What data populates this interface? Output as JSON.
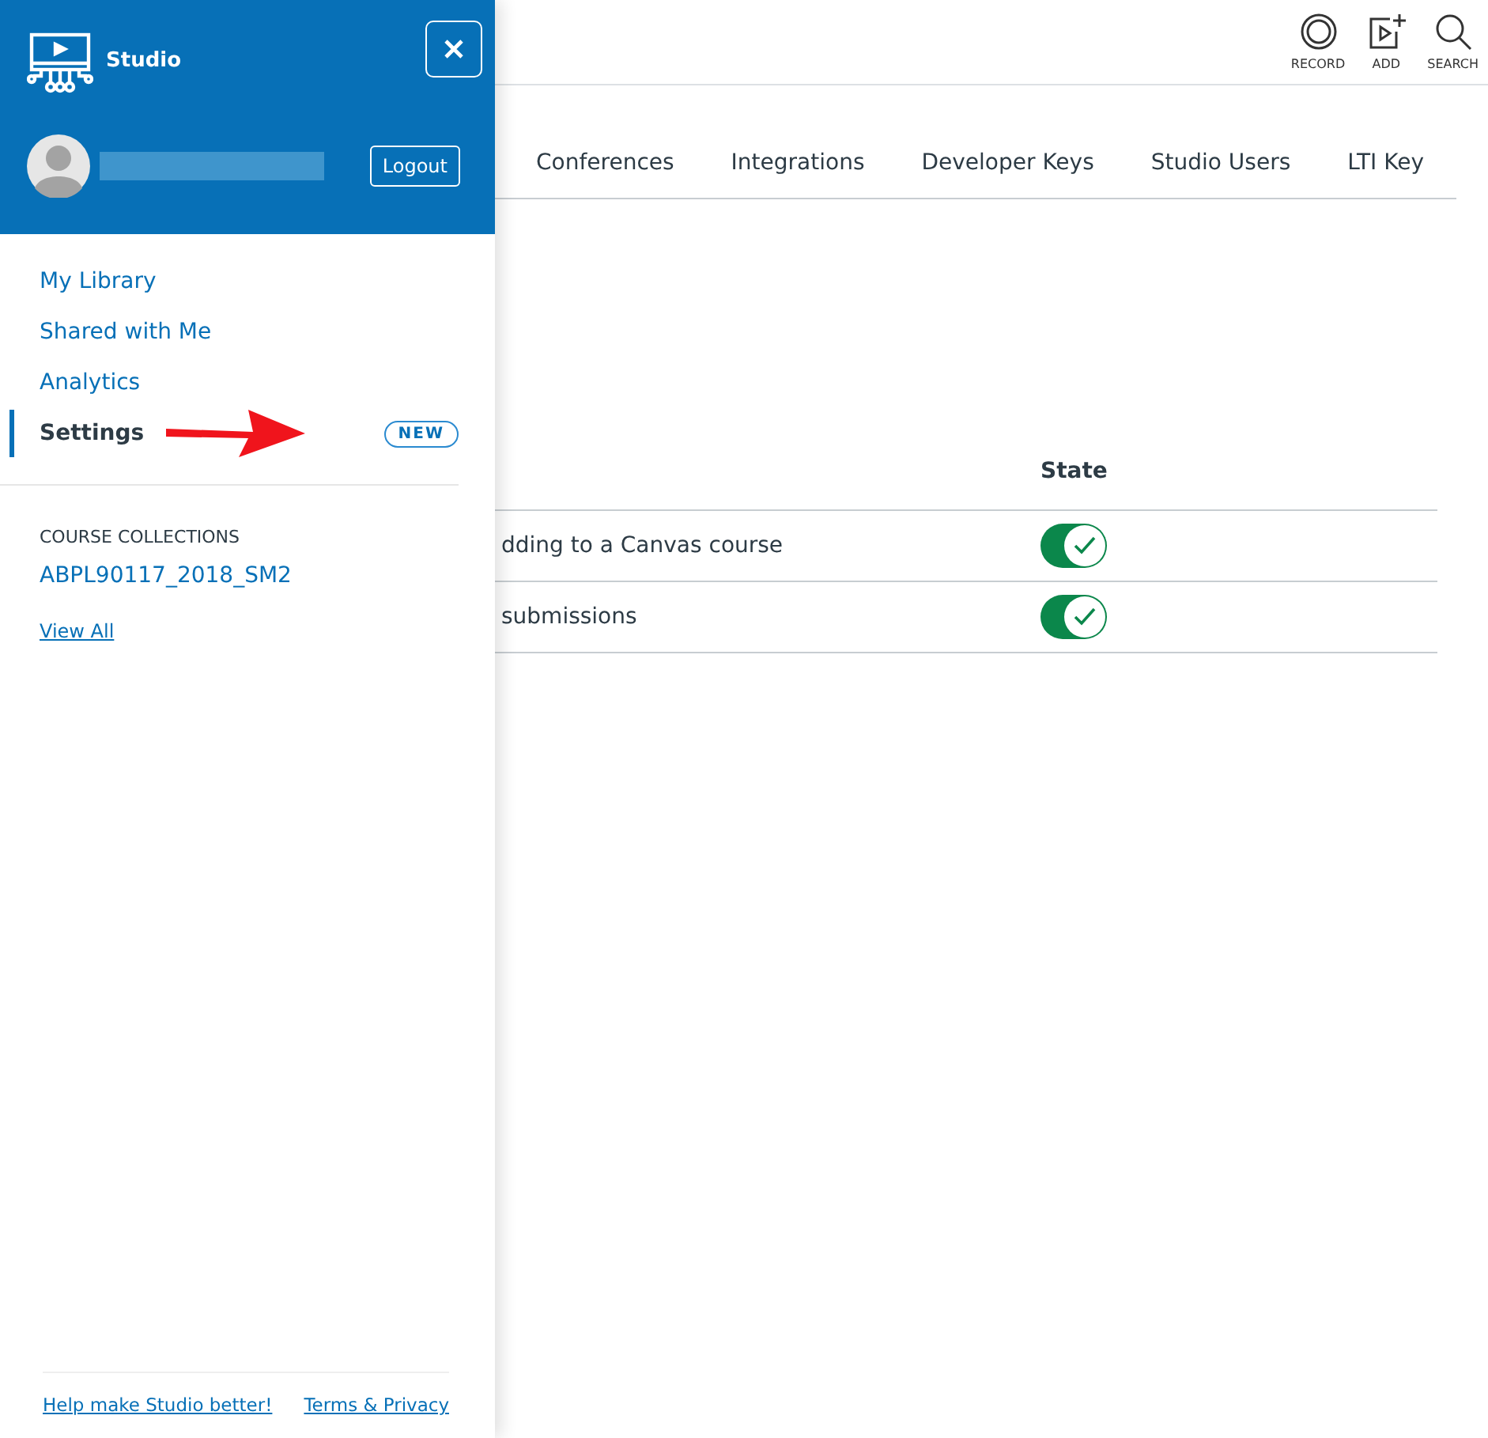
{
  "sidebar": {
    "app_name": "Studio",
    "logout": "Logout",
    "nav": [
      {
        "label": "My Library",
        "selected": false
      },
      {
        "label": "Shared with Me",
        "selected": false
      },
      {
        "label": "Analytics",
        "selected": false
      },
      {
        "label": "Settings",
        "selected": true,
        "badge": "NEW"
      }
    ],
    "collections_heading": "COURSE COLLECTIONS",
    "collections": [
      "ABPL90117_2018_SM2"
    ],
    "view_all": "View All",
    "footer_links": [
      "Help make Studio better!",
      "Terms & Privacy"
    ]
  },
  "toolbar": [
    {
      "kind": "record",
      "label": "RECORD"
    },
    {
      "kind": "add",
      "label": "ADD"
    },
    {
      "kind": "search",
      "label": "SEARCH"
    }
  ],
  "tabs": [
    "Conferences",
    "Integrations",
    "Developer Keys",
    "Studio Users",
    "LTI Key"
  ],
  "table": {
    "state_heading": "State",
    "rows": [
      {
        "label": "dding to a Canvas course",
        "on": true
      },
      {
        "label": "submissions",
        "on": true
      }
    ]
  }
}
